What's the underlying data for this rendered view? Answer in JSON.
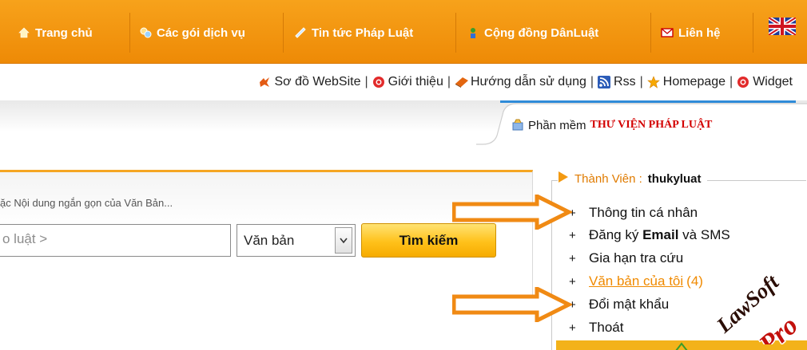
{
  "nav": {
    "items": [
      {
        "label": "Trang chủ",
        "icon": "home-icon"
      },
      {
        "label": "Các gói dịch vụ",
        "icon": "service-packages-icon"
      },
      {
        "label": "Tin tức Pháp Luật",
        "icon": "news-icon"
      },
      {
        "label": "Cộng đồng DânLuật",
        "icon": "community-icon"
      },
      {
        "label": "Liên hệ",
        "icon": "mail-icon"
      }
    ],
    "language_icon": "uk-flag-icon"
  },
  "subnav": {
    "links": [
      {
        "label": "Sơ đồ WebSite",
        "icon": "sitemap-icon"
      },
      {
        "label": "Giới thiệu",
        "icon": "info-circle-icon"
      },
      {
        "label": "Hướng dẫn sử dụng",
        "icon": "book-icon"
      },
      {
        "label": "Rss",
        "icon": "rss-icon"
      },
      {
        "label": "Homepage",
        "icon": "star-icon"
      },
      {
        "label": "Widget",
        "icon": "widget-circle-icon"
      }
    ],
    "separator": "|"
  },
  "software": {
    "prefix": "Phần mềm",
    "name": "THƯ VIỆN PHÁP LUẬT",
    "icon": "software-icon"
  },
  "search": {
    "hint": "ặc Nội dung ngắn gọn của Văn Bản...",
    "input_placeholder": "o luật >",
    "type_selected": "Văn bản",
    "button_label": "Tìm kiếm"
  },
  "member": {
    "title_label": "Thành Viên :",
    "username": "thukyluat",
    "menu": [
      {
        "plus": "+",
        "label": "Thông tin cá nhân"
      },
      {
        "plus": "+",
        "label_a": "Đăng ký ",
        "label_b": "Email",
        "label_c": " và SMS"
      },
      {
        "plus": "+",
        "label": "Gia hạn tra cứu"
      },
      {
        "plus": "+",
        "label": "Văn bản của tôi",
        "count": "(4)"
      },
      {
        "plus": "+",
        "label": "Đổi mật khẩu"
      },
      {
        "plus": "+",
        "label": "Thoát"
      }
    ]
  },
  "watermark": {
    "line1": "LawSoft",
    "line2": "Pro"
  },
  "colors": {
    "nav_orange": "#f39a12",
    "accent_orange": "#f08a00",
    "brand_red": "#d30000"
  }
}
